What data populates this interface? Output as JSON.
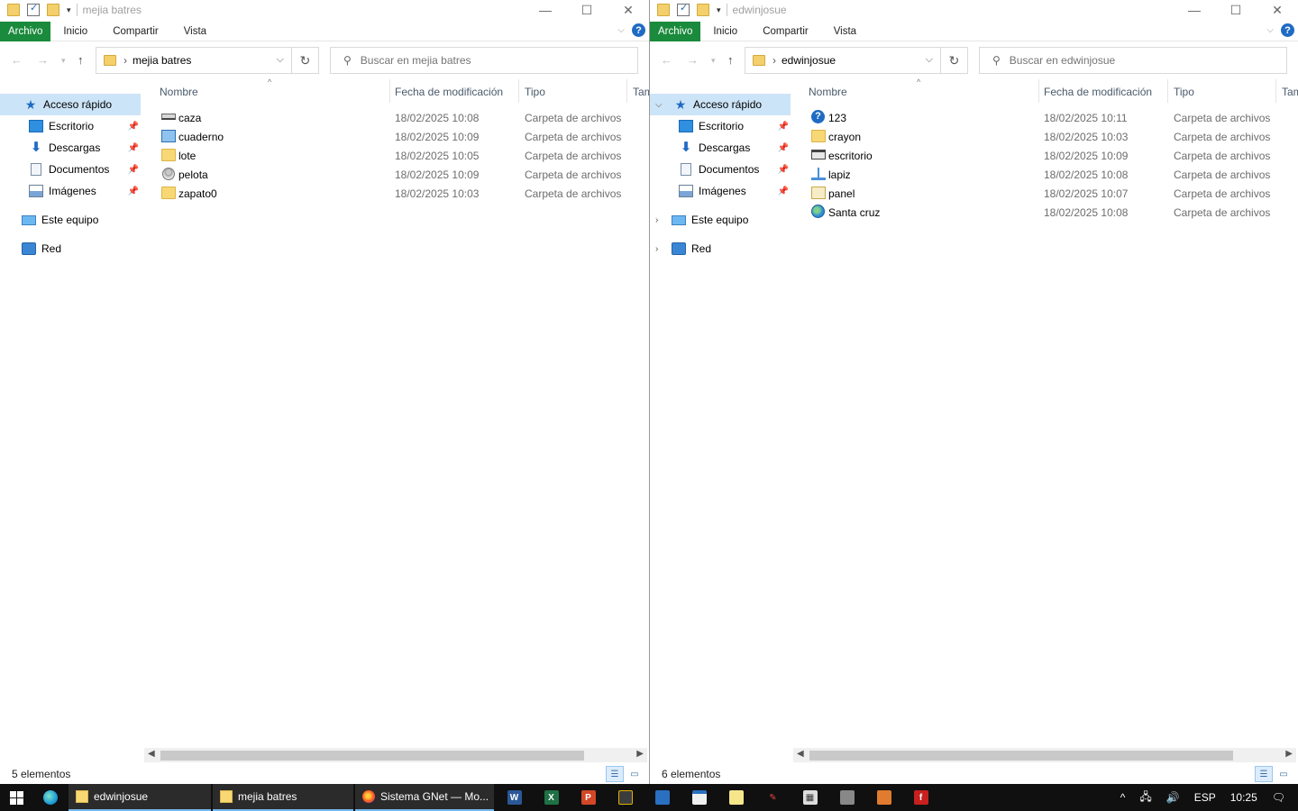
{
  "windows": [
    {
      "id": "left",
      "title": "mejia batres",
      "ribbon": {
        "file": "Archivo",
        "tabs": [
          "Inicio",
          "Compartir",
          "Vista"
        ]
      },
      "address": {
        "path": "mejia batres"
      },
      "search": {
        "placeholder": "Buscar en mejia batres"
      },
      "columns": {
        "name": "Nombre",
        "date": "Fecha de modificación",
        "type": "Tipo",
        "size": "Tam"
      },
      "sidebar": {
        "quick_access": "Acceso rápido",
        "pinned": [
          "Escritorio",
          "Descargas",
          "Documentos",
          "Imágenes"
        ],
        "this_pc": "Este equipo",
        "network": "Red"
      },
      "files": [
        {
          "name": "caza",
          "date": "18/02/2025 10:08",
          "type": "Carpeta de archivos",
          "icon": "drive-icon"
        },
        {
          "name": "cuaderno",
          "date": "18/02/2025 10:09",
          "type": "Carpeta de archivos",
          "icon": "screen-icon"
        },
        {
          "name": "lote",
          "date": "18/02/2025 10:05",
          "type": "Carpeta de archivos",
          "icon": "folder-icon"
        },
        {
          "name": "pelota",
          "date": "18/02/2025 10:09",
          "type": "Carpeta de archivos",
          "icon": "user-icon"
        },
        {
          "name": "zapato0",
          "date": "18/02/2025 10:03",
          "type": "Carpeta de archivos",
          "icon": "folder-icon"
        }
      ],
      "status": "5 elementos"
    },
    {
      "id": "right",
      "title": "edwinjosue",
      "ribbon": {
        "file": "Archivo",
        "tabs": [
          "Inicio",
          "Compartir",
          "Vista"
        ]
      },
      "address": {
        "path": "edwinjosue"
      },
      "search": {
        "placeholder": "Buscar en edwinjosue"
      },
      "columns": {
        "name": "Nombre",
        "date": "Fecha de modificación",
        "type": "Tipo",
        "size": "Tam"
      },
      "sidebar": {
        "quick_access": "Acceso rápido",
        "pinned": [
          "Escritorio",
          "Descargas",
          "Documentos",
          "Imágenes"
        ],
        "this_pc": "Este equipo",
        "network": "Red"
      },
      "files": [
        {
          "name": "123",
          "date": "18/02/2025 10:11",
          "type": "Carpeta de archivos",
          "icon": "question-icon"
        },
        {
          "name": "crayon",
          "date": "18/02/2025 10:03",
          "type": "Carpeta de archivos",
          "icon": "folder-icon"
        },
        {
          "name": "escritorio",
          "date": "18/02/2025 10:09",
          "type": "Carpeta de archivos",
          "icon": "printer-icon"
        },
        {
          "name": "lapiz",
          "date": "18/02/2025 10:08",
          "type": "Carpeta de archivos",
          "icon": "network-icon"
        },
        {
          "name": "panel",
          "date": "18/02/2025 10:07",
          "type": "Carpeta de archivos",
          "icon": "panel-icon"
        },
        {
          "name": "Santa cruz",
          "date": "18/02/2025 10:08",
          "type": "Carpeta de archivos",
          "icon": "globe-icon"
        }
      ],
      "status": "6 elementos"
    }
  ],
  "taskbar": {
    "tasks": [
      "edwinjosue",
      "mejia batres",
      "Sistema GNet — Mo..."
    ],
    "tray": {
      "lang": "ESP",
      "time": "10:25"
    }
  },
  "colors": {
    "file_tab": "#1a8a3c",
    "selection": "#cce4f7",
    "accent": "#1f6bc4"
  }
}
